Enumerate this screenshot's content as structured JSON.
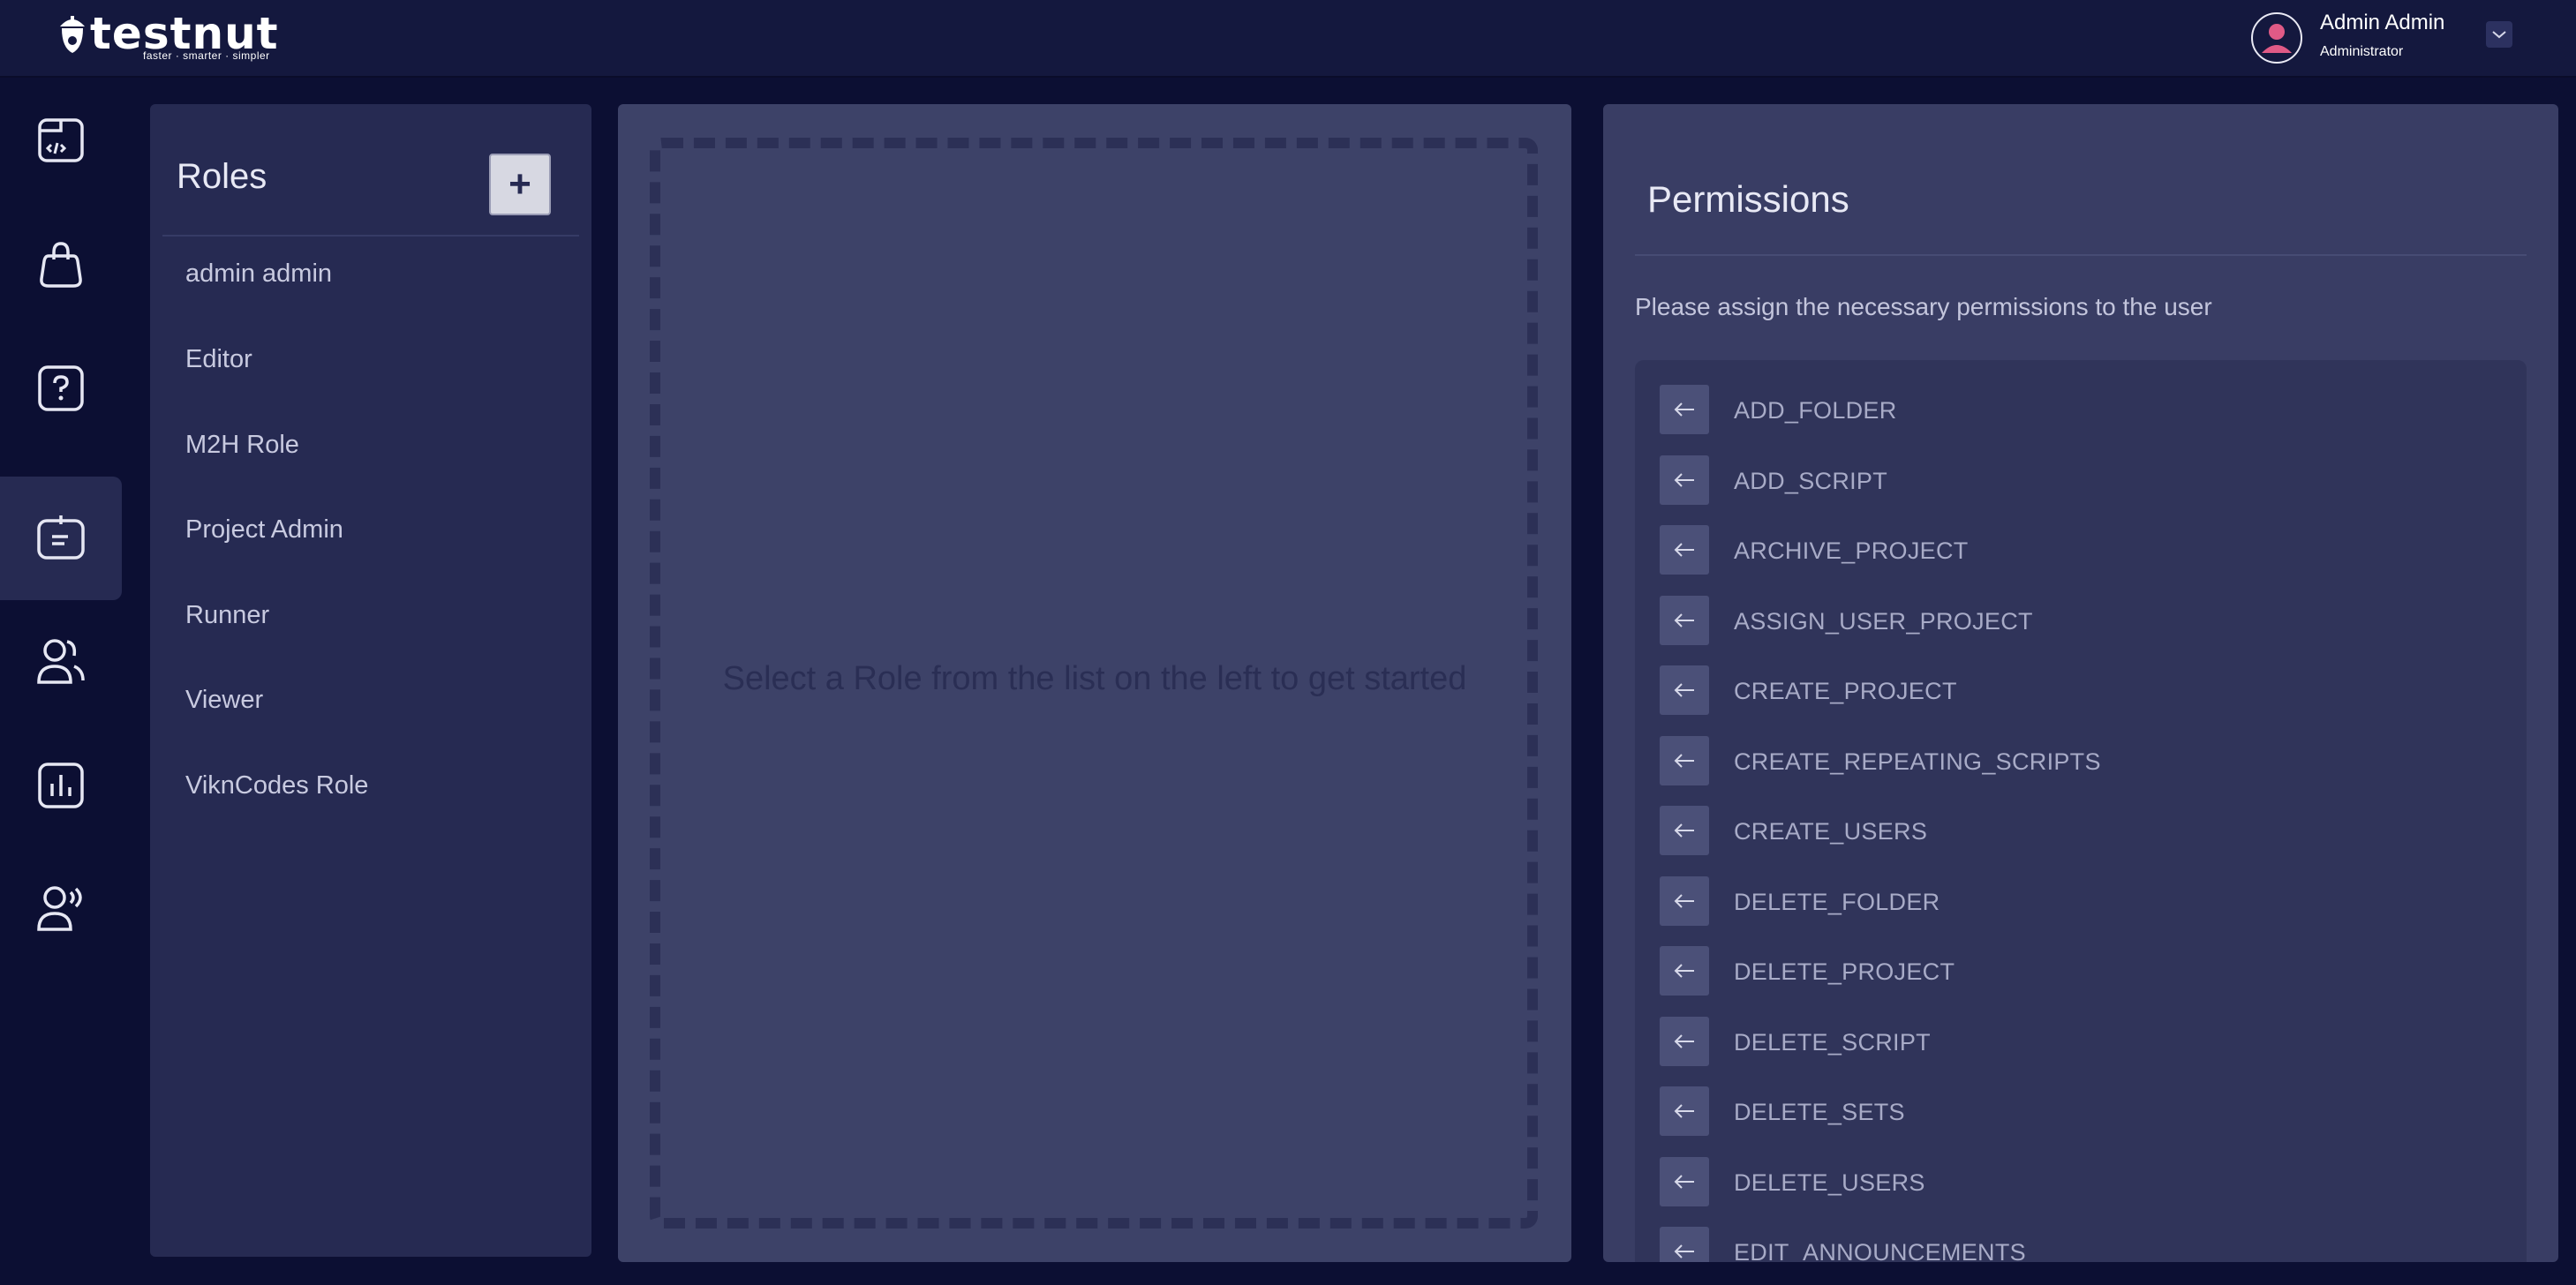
{
  "header": {
    "logo_text": "testnut",
    "logo_tagline": "faster · smarter · simpler",
    "user_name": "Admin Admin",
    "user_role": "Administrator"
  },
  "sidenav": {
    "items": [
      {
        "icon": "code-window-icon"
      },
      {
        "icon": "shopping-bag-icon"
      },
      {
        "icon": "help-icon"
      },
      {
        "icon": "roles-icon",
        "active": true
      },
      {
        "icon": "users-icon"
      },
      {
        "icon": "reports-icon"
      },
      {
        "icon": "user-voice-icon"
      }
    ]
  },
  "roles": {
    "title": "Roles",
    "add_label": "+",
    "items": [
      "admin admin",
      "Editor",
      "M2H Role",
      "Project Admin",
      "Runner",
      "Viewer",
      "ViknCodes Role"
    ]
  },
  "center": {
    "message": "Select a Role from the list on the left to get started"
  },
  "permissions": {
    "title": "Permissions",
    "subtitle": "Please assign the necessary permissions to the user",
    "items": [
      "ADD_FOLDER",
      "ADD_SCRIPT",
      "ARCHIVE_PROJECT",
      "ASSIGN_USER_PROJECT",
      "CREATE_PROJECT",
      "CREATE_REPEATING_SCRIPTS",
      "CREATE_USERS",
      "DELETE_FOLDER",
      "DELETE_PROJECT",
      "DELETE_SCRIPT",
      "DELETE_SETS",
      "DELETE_USERS",
      "EDIT_ANNOUNCEMENTS"
    ]
  },
  "colors": {
    "background": "#0c0f33",
    "topbar": "#14183e",
    "panel": "#262a52",
    "center_panel": "#3d4268",
    "permissions_panel": "#393d64",
    "avatar_accent": "#e05a86"
  }
}
